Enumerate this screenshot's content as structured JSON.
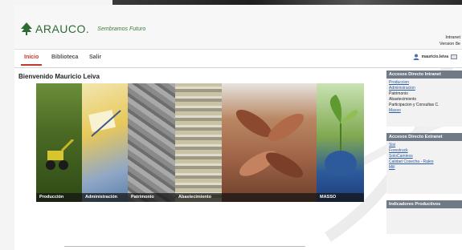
{
  "brand": {
    "name": "ARAUCO.",
    "tagline": "Sembramos Futuro",
    "color": "#2c6b34"
  },
  "header": {
    "intranet_label": "Intranet",
    "version_label": "Version 8e"
  },
  "nav": {
    "tabs": [
      {
        "label": "Inicio",
        "active": true
      },
      {
        "label": "Biblioteca",
        "active": false
      },
      {
        "label": "Salir",
        "active": false
      }
    ],
    "user_name": "mauricio.leiva",
    "accent": "#c0392b"
  },
  "main": {
    "welcome": "Bienvenido Mauricio Leiva",
    "banner_panels": [
      {
        "label": "Producción"
      },
      {
        "label": "Administración"
      },
      {
        "label": "Patrimonio"
      },
      {
        "label": "Abastecimiento"
      },
      {
        "label": ""
      },
      {
        "label": "MASSO"
      }
    ]
  },
  "sidebar": {
    "intranet": {
      "title": "Accesos Directo Intranet",
      "items": [
        {
          "label": "Produccion",
          "link": true
        },
        {
          "label": "Administracion",
          "link": true
        },
        {
          "label": "Patrimonio",
          "link": false
        },
        {
          "label": "Abastecimiento",
          "link": false
        },
        {
          "label": "Participacion y Consultas C.",
          "link": false
        },
        {
          "label": "Masso",
          "link": true
        }
      ]
    },
    "extranet": {
      "title": "Accesos Directo Extranet",
      "items": [
        {
          "label": "Sisi",
          "link": true
        },
        {
          "label": "Forestruck",
          "link": true
        },
        {
          "label": "SoloCaminos",
          "link": true
        },
        {
          "label": "Calidad Cosecha - Raleo",
          "link": true
        },
        {
          "label": "Mill",
          "link": true
        }
      ]
    },
    "indicadores": {
      "title": "Indicadores Productivos"
    }
  }
}
